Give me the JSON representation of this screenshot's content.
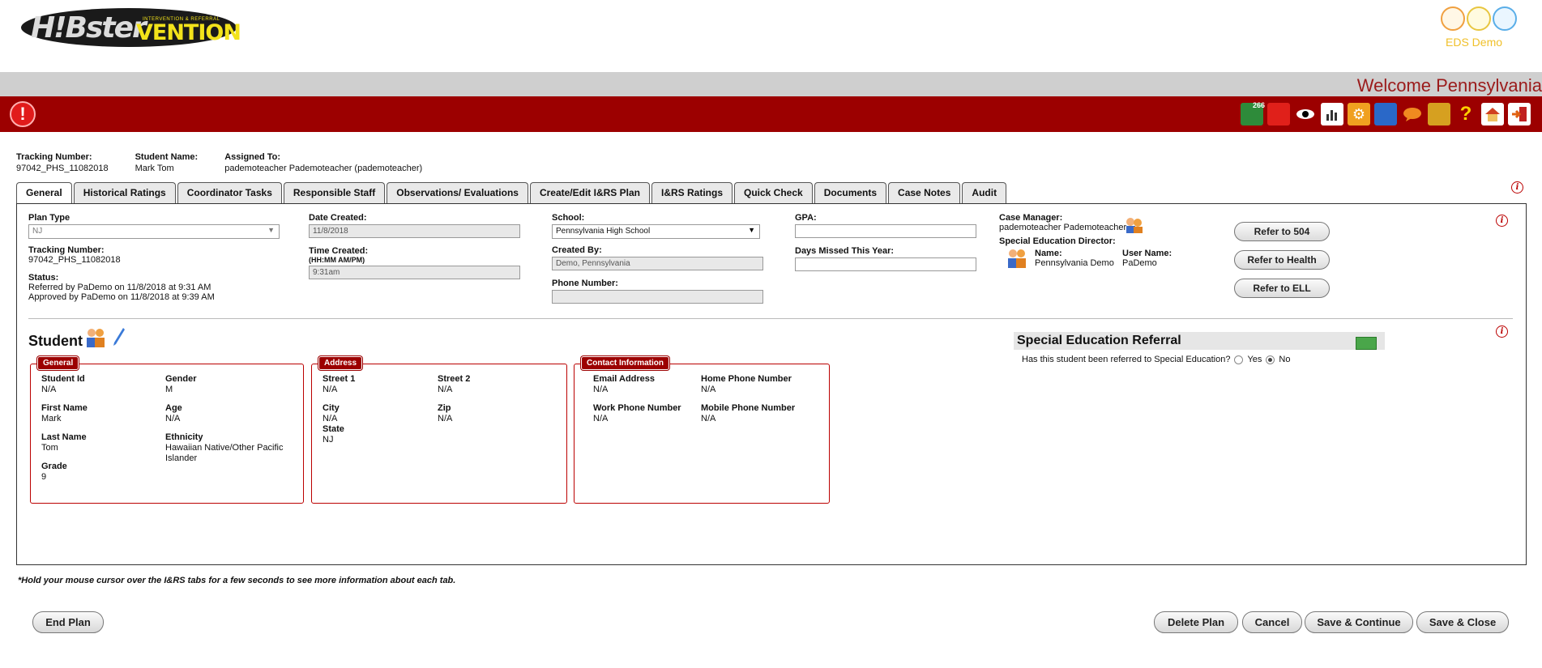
{
  "header": {
    "logo_text": "H!Bster",
    "logo_vention": "VENTION",
    "logo_sub": "INTERVENTION & REFERRAL",
    "eds_label": "EDS Demo",
    "welcome": "Welcome Pennsylvania"
  },
  "toolbar": {
    "icons": [
      "inbox-icon",
      "folder-icon",
      "eye-icon",
      "report-icon",
      "gear-icon",
      "people-icon",
      "chat-icon",
      "books-icon",
      "help-icon",
      "home-icon",
      "logout-icon"
    ],
    "inbox_count": "266"
  },
  "summary": {
    "tracking_label": "Tracking Number:",
    "tracking_value": "97042_PHS_11082018",
    "student_label": "Student Name:",
    "student_value": "Mark Tom",
    "assigned_label": "Assigned To:",
    "assigned_value": "pademoteacher Pademoteacher (pademoteacher)"
  },
  "tabs": [
    "General",
    "Historical Ratings",
    "Coordinator Tasks",
    "Responsible Staff",
    "Observations/ Evaluations",
    "Create/Edit I&RS Plan",
    "I&RS Ratings",
    "Quick Check",
    "Documents",
    "Case Notes",
    "Audit"
  ],
  "general": {
    "plan_type_label": "Plan Type",
    "plan_type_value": "NJ",
    "tracking_label": "Tracking Number:",
    "tracking_value": "97042_PHS_11082018",
    "status_label": "Status:",
    "status_line1": "Referred by PaDemo on 11/8/2018 at 9:31 AM",
    "status_line2": "Approved by PaDemo on 11/8/2018 at 9:39 AM",
    "date_created_label": "Date Created:",
    "date_created_value": "11/8/2018",
    "time_created_label": "Time Created:",
    "time_format": "(HH:MM AM/PM)",
    "time_created_value": "9:31am",
    "school_label": "School:",
    "school_value": "Pennsylvania High School",
    "created_by_label": "Created By:",
    "created_by_value": "Demo, Pennsylvania",
    "phone_label": "Phone Number:",
    "phone_value": "",
    "gpa_label": "GPA:",
    "gpa_value": "",
    "days_missed_label": "Days Missed This Year:",
    "days_missed_value": "",
    "case_manager_label": "Case Manager:",
    "case_manager_value": "pademoteacher Pademoteacher",
    "sped_director_label": "Special Education Director:",
    "name_label": "Name:",
    "name_value": "Pennsylvania Demo",
    "user_label": "User Name:",
    "user_value": "PaDemo",
    "refer_504": "Refer to 504",
    "refer_health": "Refer to Health",
    "refer_ell": "Refer to ELL"
  },
  "student": {
    "title": "Student",
    "general_tag": "General",
    "student_id_label": "Student Id",
    "student_id_value": "N/A",
    "gender_label": "Gender",
    "gender_value": "M",
    "first_name_label": "First Name",
    "first_name_value": "Mark",
    "age_label": "Age",
    "age_value": "N/A",
    "last_name_label": "Last Name",
    "last_name_value": "Tom",
    "ethnicity_label": "Ethnicity",
    "ethnicity_value": "Hawaiian Native/Other Pacific Islander",
    "grade_label": "Grade",
    "grade_value": "9",
    "address_tag": "Address",
    "street1_label": "Street 1",
    "street1_value": "N/A",
    "street2_label": "Street 2",
    "street2_value": "N/A",
    "city_label": "City",
    "city_value": "N/A",
    "zip_label": "Zip",
    "zip_value": "N/A",
    "state_label": "State",
    "state_value": "NJ",
    "contact_tag": "Contact Information",
    "email_label": "Email Address",
    "email_value": "N/A",
    "home_phone_label": "Home Phone Number",
    "home_phone_value": "N/A",
    "work_phone_label": "Work Phone Number",
    "work_phone_value": "N/A",
    "mobile_phone_label": "Mobile Phone Number",
    "mobile_phone_value": "N/A"
  },
  "sped": {
    "title": "Special Education Referral",
    "question": "Has this student been referred to Special Education?",
    "yes": "Yes",
    "no": "No",
    "selected": "No"
  },
  "footer": {
    "note": "*Hold your mouse cursor over the I&RS tabs for a few seconds to see more information about each tab.",
    "end_plan": "End Plan",
    "delete_plan": "Delete Plan",
    "cancel": "Cancel",
    "save_continue": "Save & Continue",
    "save_close": "Save & Close"
  },
  "colors": {
    "brand_red": "#9c0000",
    "band_grey": "#cfcfcf",
    "welcome_text": "#9b1b1b"
  }
}
